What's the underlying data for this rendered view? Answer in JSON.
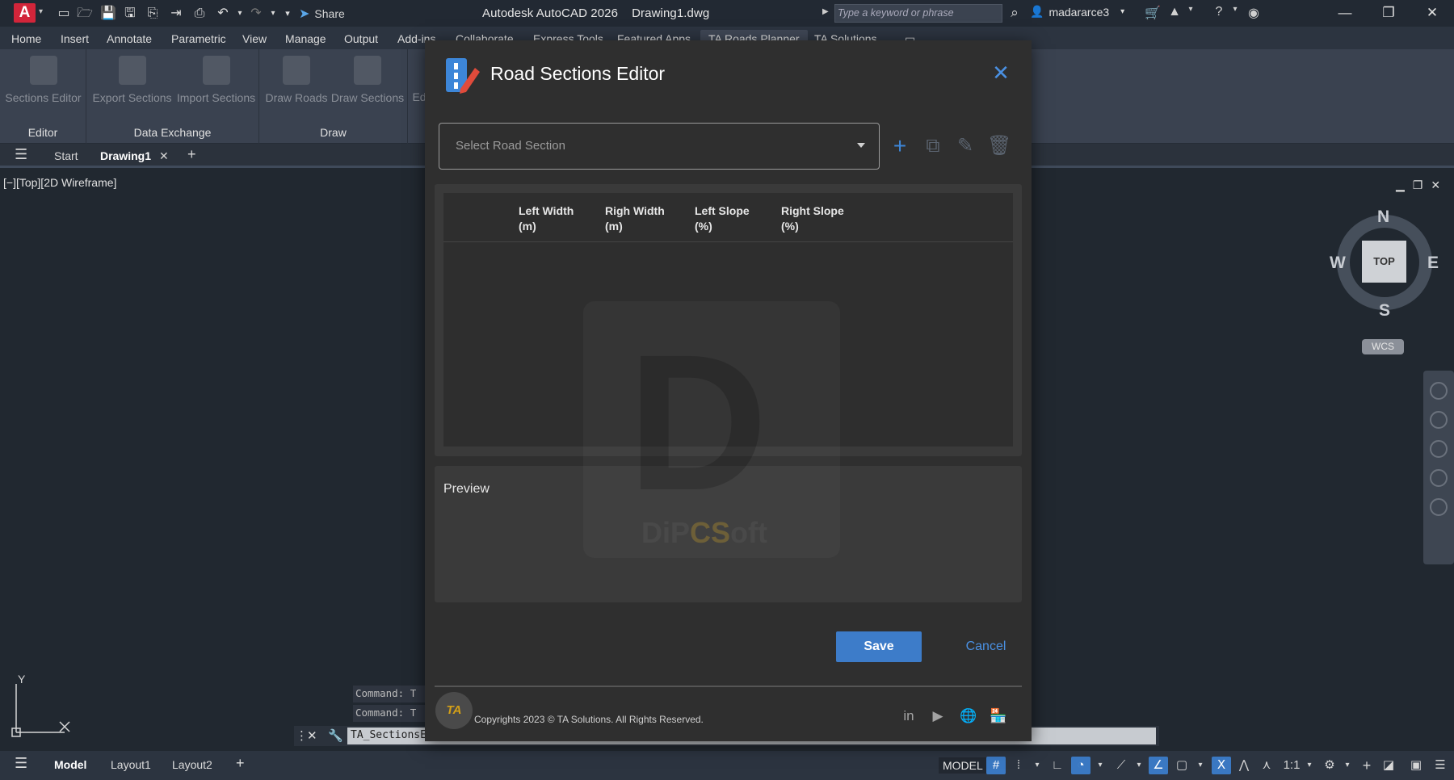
{
  "titlebar": {
    "app_logo": "A",
    "share_label": "Share",
    "title": "Autodesk AutoCAD 2026    Drawing1.dwg",
    "search_placeholder": "Type a keyword or phrase",
    "username": "madararce3"
  },
  "ribbon_tabs": [
    "Home",
    "Insert",
    "Annotate",
    "Parametric",
    "View",
    "Manage",
    "Output",
    "Add-ins",
    "Collaborate",
    "Express Tools",
    "Featured Apps",
    "TA Roads Planner",
    "TA Solutions"
  ],
  "ribbon": {
    "groups": [
      {
        "label": "Editor",
        "buttons": [
          "Sections Editor"
        ]
      },
      {
        "label": "Data Exchange",
        "buttons": [
          "Export Sections",
          "Import Sections"
        ]
      },
      {
        "label": "Draw",
        "buttons": [
          "Draw Roads",
          "Draw Sections"
        ]
      }
    ],
    "cut_button": "Ed"
  },
  "doc_tabs": {
    "start": "Start",
    "active": "Drawing1"
  },
  "viewport": {
    "label": "[−][Top][2D Wireframe]"
  },
  "viewcube": {
    "top": "TOP",
    "n": "N",
    "s": "S",
    "e": "E",
    "w": "W",
    "wcs": "WCS"
  },
  "ucs": {
    "y": "Y"
  },
  "command": {
    "history": [
      "Command: T",
      "Command: T"
    ],
    "input": "TA_SectionsEditor"
  },
  "statusbar": {
    "tabs": [
      "Model",
      "Layout1",
      "Layout2"
    ],
    "model_label": "MODEL",
    "scale": "1:1"
  },
  "dialog": {
    "title": "Road Sections Editor",
    "select_placeholder": "Select Road Section",
    "columns": [
      "Left Width (m)",
      "Righ Width (m)",
      "Left Slope (%)",
      "Right Slope (%)"
    ],
    "columns_split": [
      [
        "Left Width",
        "(m)"
      ],
      [
        "Righ Width",
        "(m)"
      ],
      [
        "Left Slope",
        "(%)"
      ],
      [
        "Right Slope",
        "(%)"
      ]
    ],
    "preview_label": "Preview",
    "save_label": "Save",
    "cancel_label": "Cancel",
    "footer_logo": "TA",
    "copyright": "Copyrights 2023 © TA Solutions. All Rights Reserved.",
    "watermark": {
      "letter": "D",
      "text_a": "DiP",
      "text_b": "CS",
      "text_c": "oft"
    }
  },
  "colors": {
    "accent": "#3d7cc9",
    "link": "#4a90e2",
    "autocad_red": "#d2253a"
  }
}
